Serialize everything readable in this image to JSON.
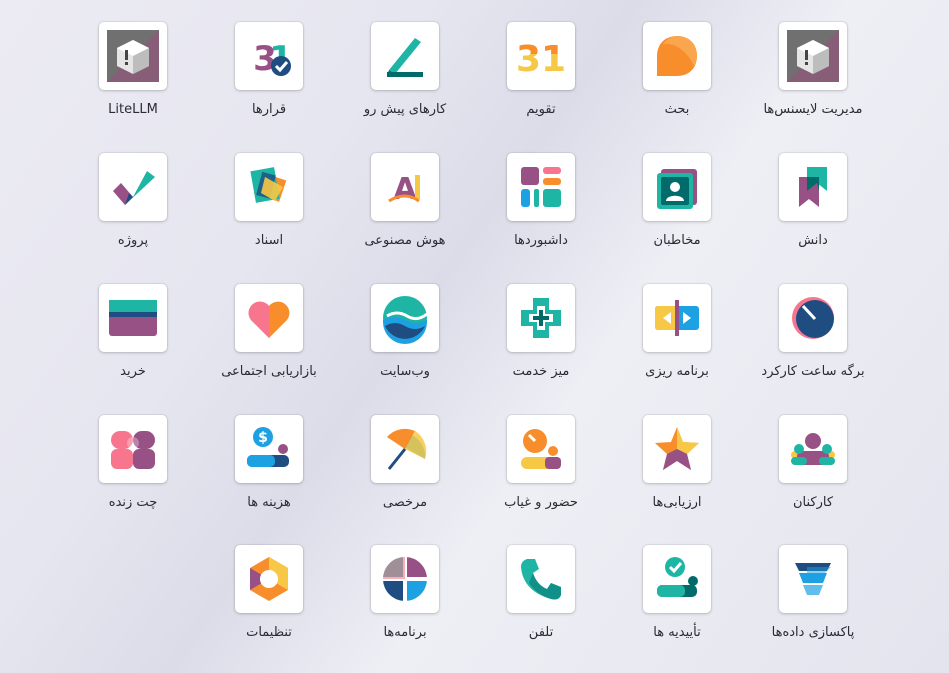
{
  "apps": [
    {
      "key": "license-management",
      "label": "مدیریت لایسنس‌ها",
      "icon": "box-icon"
    },
    {
      "key": "discuss",
      "label": "بحث",
      "icon": "chat-bubble-icon"
    },
    {
      "key": "calendar",
      "label": "تقویم",
      "icon": "calendar-31-icon"
    },
    {
      "key": "todo",
      "label": "کارهای پیش رو",
      "icon": "pen-stroke-icon"
    },
    {
      "key": "appointments",
      "label": "قرارها",
      "icon": "calendar-check-icon"
    },
    {
      "key": "litellm",
      "label": "LiteLLM",
      "icon": "box-icon"
    },
    {
      "key": "knowledge",
      "label": "دانش",
      "icon": "bookmark-icon"
    },
    {
      "key": "contacts",
      "label": "مخاطبان",
      "icon": "contact-card-icon"
    },
    {
      "key": "dashboards",
      "label": "داشبوردها",
      "icon": "dashboard-icon"
    },
    {
      "key": "ai",
      "label": "هوش مصنوعی",
      "icon": "ai-icon"
    },
    {
      "key": "documents",
      "label": "اسناد",
      "icon": "documents-icon"
    },
    {
      "key": "project",
      "label": "پروژه",
      "icon": "check-icon"
    },
    {
      "key": "timesheets",
      "label": "برگه ساعت کارکرد",
      "icon": "timer-icon"
    },
    {
      "key": "planning",
      "label": "برنامه ریزی",
      "icon": "planning-arrows-icon"
    },
    {
      "key": "helpdesk",
      "label": "میز خدمت",
      "icon": "cross-lifebuoy-icon"
    },
    {
      "key": "website",
      "label": "وب‌سایت",
      "icon": "globe-wave-icon"
    },
    {
      "key": "social-marketing",
      "label": "بازاریابی اجتماعی",
      "icon": "heart-icon"
    },
    {
      "key": "purchase",
      "label": "خرید",
      "icon": "credit-card-icon"
    },
    {
      "key": "employees",
      "label": "کارکنان",
      "icon": "people-icon"
    },
    {
      "key": "appraisals",
      "label": "ارزیابی‌ها",
      "icon": "star-icon"
    },
    {
      "key": "attendances",
      "label": "حضور و غیاب",
      "icon": "attendance-icon"
    },
    {
      "key": "time-off",
      "label": "مرخصی",
      "icon": "umbrella-icon"
    },
    {
      "key": "expenses",
      "label": "هزینه ها",
      "icon": "money-hand-icon"
    },
    {
      "key": "live-chat",
      "label": "چت زنده",
      "icon": "live-chat-icon"
    },
    {
      "key": "data-cleaning",
      "label": "پاکسازی داده‌ها",
      "icon": "data-cleaning-icon"
    },
    {
      "key": "approvals",
      "label": "تأییدیه ها",
      "icon": "approval-icon"
    },
    {
      "key": "phone",
      "label": "تلفن",
      "icon": "phone-icon"
    },
    {
      "key": "apps",
      "label": "برنامه‌ها",
      "icon": "apps-wheel-icon"
    },
    {
      "key": "settings",
      "label": "تنظیمات",
      "icon": "settings-hexagon-icon"
    }
  ],
  "icon_texts": {
    "calendar_number": "31",
    "ai_letters": "AI"
  },
  "colors": {
    "teal": "#1fb5a4",
    "purple": "#985184",
    "orange": "#f88e2b",
    "yellow": "#f7c845",
    "blue": "#1ea1e3",
    "navy": "#1f4d82",
    "pink": "#f7768e",
    "dark_teal": "#016b6b",
    "dark": "#374153"
  }
}
